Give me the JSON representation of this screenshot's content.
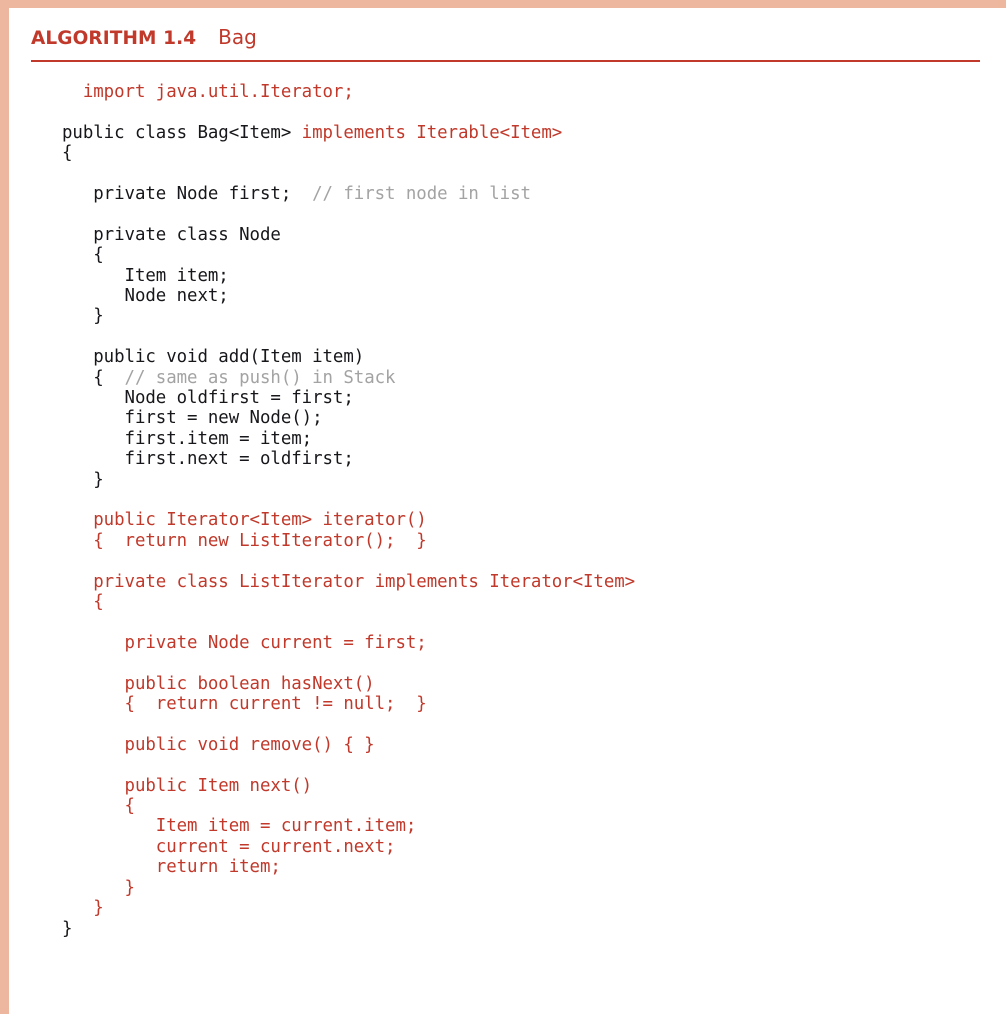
{
  "header": {
    "algorithm_number": "ALGORITHM 1.4",
    "title": "Bag"
  },
  "colors": {
    "accent_red": "#c0392b",
    "code_black": "#17171b",
    "comment_gray": "#a3a3a3",
    "border_salmon": "#edb79f",
    "background": "#ffffff"
  },
  "code": {
    "language": "Java",
    "lines": [
      {
        "id": 1,
        "gap": false,
        "spans": [
          {
            "t": "  import java.util.Iterator;",
            "c": "red"
          }
        ]
      },
      {
        "id": 2,
        "gap": true,
        "spans": [
          {
            "t": "public class Bag<Item> ",
            "c": "black"
          },
          {
            "t": "implements Iterable<Item>",
            "c": "red"
          }
        ]
      },
      {
        "id": 3,
        "gap": false,
        "spans": [
          {
            "t": "{",
            "c": "black"
          }
        ]
      },
      {
        "id": 4,
        "gap": true,
        "spans": [
          {
            "t": "   private Node first;  ",
            "c": "black"
          },
          {
            "t": "// first node in list",
            "c": "comment"
          }
        ]
      },
      {
        "id": 5,
        "gap": true,
        "spans": [
          {
            "t": "   private class Node",
            "c": "black"
          }
        ]
      },
      {
        "id": 6,
        "gap": false,
        "spans": [
          {
            "t": "   {",
            "c": "black"
          }
        ]
      },
      {
        "id": 7,
        "gap": false,
        "spans": [
          {
            "t": "      Item item;",
            "c": "black"
          }
        ]
      },
      {
        "id": 8,
        "gap": false,
        "spans": [
          {
            "t": "      Node next;",
            "c": "black"
          }
        ]
      },
      {
        "id": 9,
        "gap": false,
        "spans": [
          {
            "t": "   }",
            "c": "black"
          }
        ]
      },
      {
        "id": 10,
        "gap": true,
        "spans": [
          {
            "t": "   public void add(Item item)",
            "c": "black"
          }
        ]
      },
      {
        "id": 11,
        "gap": false,
        "spans": [
          {
            "t": "   {  ",
            "c": "black"
          },
          {
            "t": "// same as push() in Stack",
            "c": "comment"
          }
        ]
      },
      {
        "id": 12,
        "gap": false,
        "spans": [
          {
            "t": "      Node oldfirst = first;",
            "c": "black"
          }
        ]
      },
      {
        "id": 13,
        "gap": false,
        "spans": [
          {
            "t": "      first = new Node();",
            "c": "black"
          }
        ]
      },
      {
        "id": 14,
        "gap": false,
        "spans": [
          {
            "t": "      first.item = item;",
            "c": "black"
          }
        ]
      },
      {
        "id": 15,
        "gap": false,
        "spans": [
          {
            "t": "      first.next = oldfirst;",
            "c": "black"
          }
        ]
      },
      {
        "id": 16,
        "gap": false,
        "spans": [
          {
            "t": "   }",
            "c": "black"
          }
        ]
      },
      {
        "id": 17,
        "gap": true,
        "spans": [
          {
            "t": "   public Iterator<Item> iterator()",
            "c": "red"
          }
        ]
      },
      {
        "id": 18,
        "gap": false,
        "spans": [
          {
            "t": "   {  return new ListIterator();  }",
            "c": "red"
          }
        ]
      },
      {
        "id": 19,
        "gap": true,
        "spans": [
          {
            "t": "   private class ListIterator implements Iterator<Item>",
            "c": "red"
          }
        ]
      },
      {
        "id": 20,
        "gap": false,
        "spans": [
          {
            "t": "   {",
            "c": "red"
          }
        ]
      },
      {
        "id": 21,
        "gap": true,
        "spans": [
          {
            "t": "      private Node current = first;",
            "c": "red"
          }
        ]
      },
      {
        "id": 22,
        "gap": true,
        "spans": [
          {
            "t": "      public boolean hasNext()",
            "c": "red"
          }
        ]
      },
      {
        "id": 23,
        "gap": false,
        "spans": [
          {
            "t": "      {  return current != null;  }",
            "c": "red"
          }
        ]
      },
      {
        "id": 24,
        "gap": true,
        "spans": [
          {
            "t": "      public void remove() { }",
            "c": "red"
          }
        ]
      },
      {
        "id": 25,
        "gap": true,
        "spans": [
          {
            "t": "      public Item next()",
            "c": "red"
          }
        ]
      },
      {
        "id": 26,
        "gap": false,
        "spans": [
          {
            "t": "      {",
            "c": "red"
          }
        ]
      },
      {
        "id": 27,
        "gap": false,
        "spans": [
          {
            "t": "         Item item = current.item;",
            "c": "red"
          }
        ]
      },
      {
        "id": 28,
        "gap": false,
        "spans": [
          {
            "t": "         current = current.next;",
            "c": "red"
          }
        ]
      },
      {
        "id": 29,
        "gap": false,
        "spans": [
          {
            "t": "         return item;",
            "c": "red"
          }
        ]
      },
      {
        "id": 30,
        "gap": false,
        "spans": [
          {
            "t": "      }",
            "c": "red"
          }
        ]
      },
      {
        "id": 31,
        "gap": false,
        "spans": [
          {
            "t": "   }",
            "c": "red"
          }
        ]
      },
      {
        "id": 32,
        "gap": false,
        "spans": [
          {
            "t": "}",
            "c": "black"
          }
        ]
      }
    ]
  }
}
